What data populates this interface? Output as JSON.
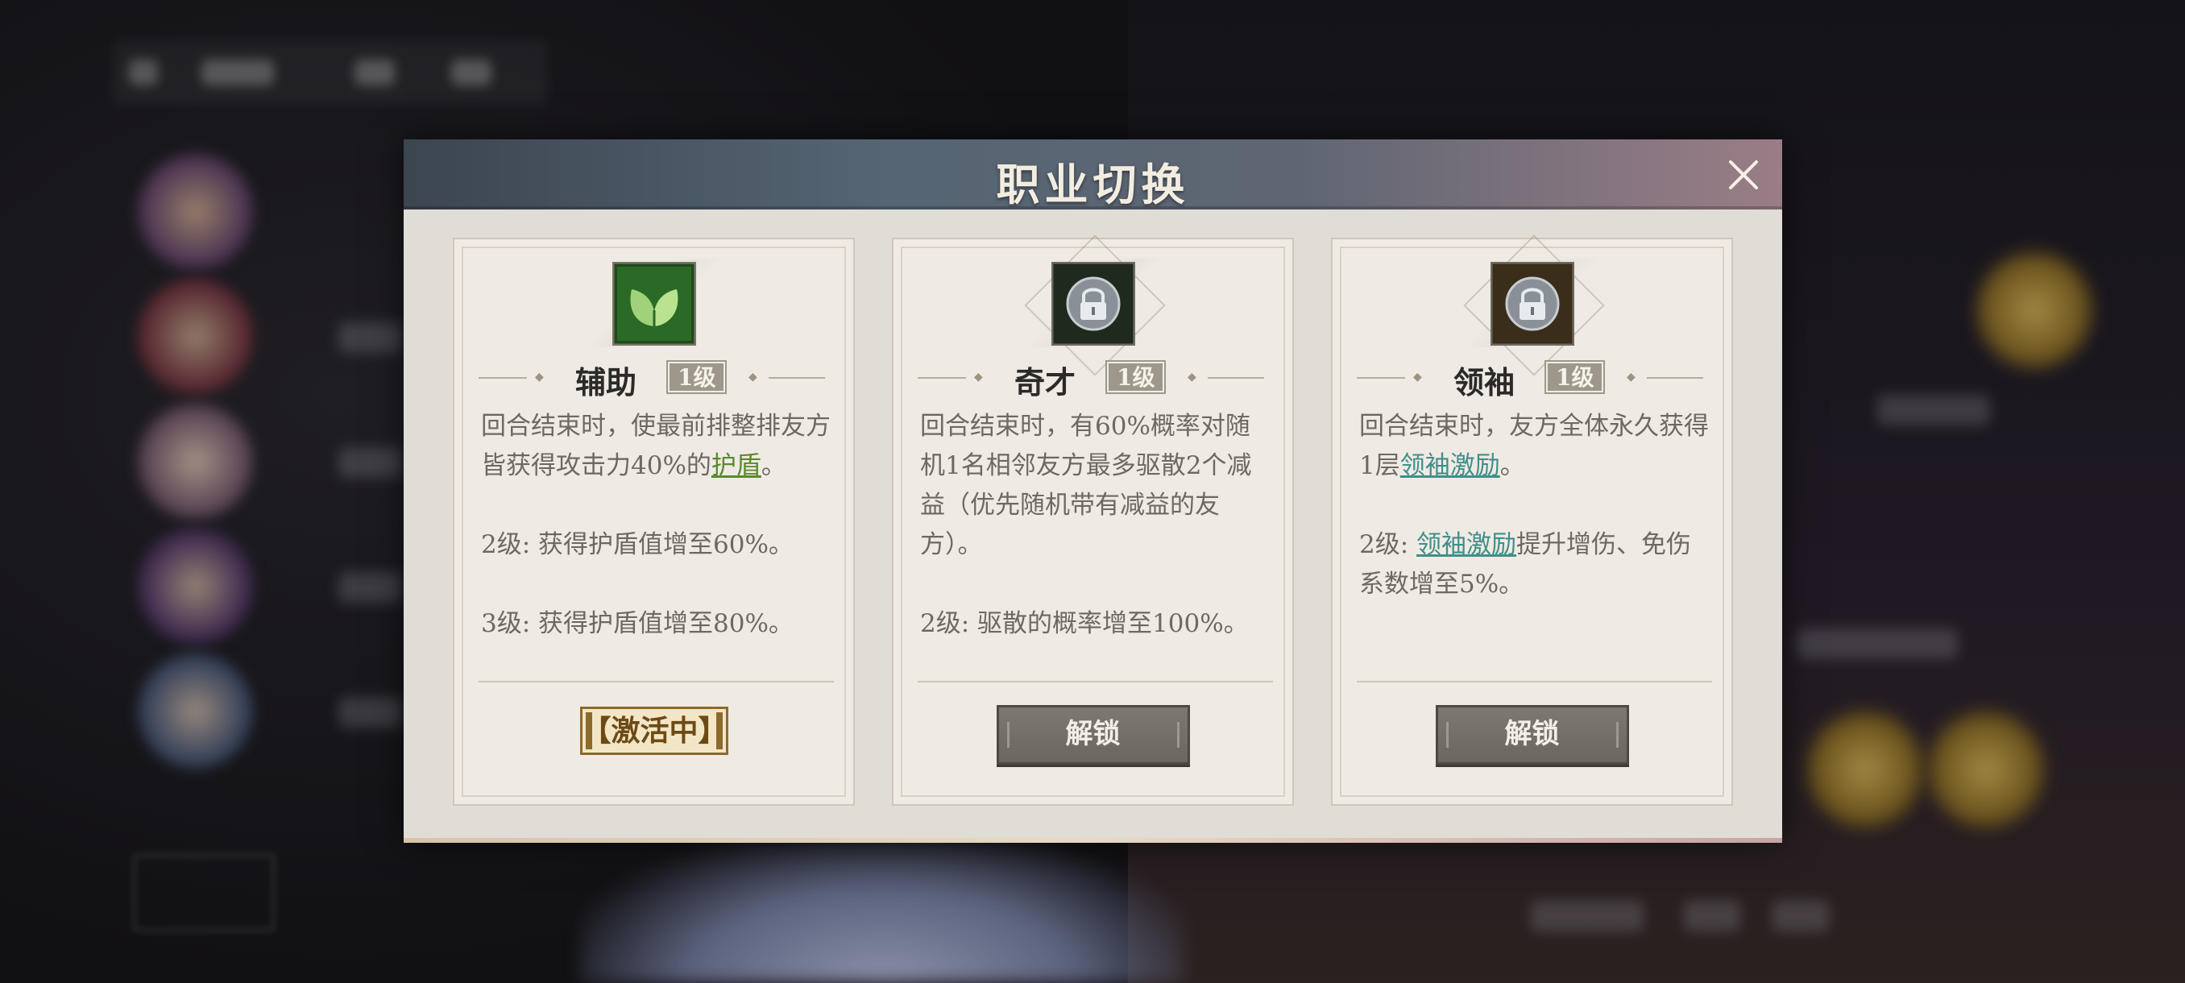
{
  "modal": {
    "title": "职业切换",
    "close_icon": "close-icon"
  },
  "cards": [
    {
      "name": "辅助",
      "level": "1级",
      "icon": "leaf-icon",
      "desc_1_pre": "回合结束时，使最前排整排友方皆获得攻击力40%的",
      "desc_1_link": "护盾",
      "desc_1_post": "。",
      "desc_2": "2级: 获得护盾值增至60%。",
      "desc_3": "3级: 获得护盾值增至80%。",
      "status": "【激活中】"
    },
    {
      "name": "奇才",
      "level": "1级",
      "icon": "lock-icon",
      "desc_1": "回合结束时，有60%概率对随机1名相邻友方最多驱散2个减益（优先随机带有减益的友方）。",
      "desc_2": "2级: 驱散的概率增至100%。",
      "button": "解锁"
    },
    {
      "name": "领袖",
      "level": "1级",
      "icon": "lock-icon",
      "desc_1_pre": "回合结束时，友方全体永久获得1层",
      "desc_1_link": "领袖激励",
      "desc_1_post": "。",
      "desc_2_pre": "2级: ",
      "desc_2_link": "领袖激励",
      "desc_2_post": "提升增伤、免伤系数增至5%。",
      "button": "解锁"
    }
  ],
  "colors": {
    "header_left": "#3c4550",
    "header_right": "#9a7d86",
    "card_bg": "#efebe4",
    "active_border": "#8c6a2c",
    "link_green": "#5a8a2e",
    "link_teal": "#3f8f8a"
  }
}
